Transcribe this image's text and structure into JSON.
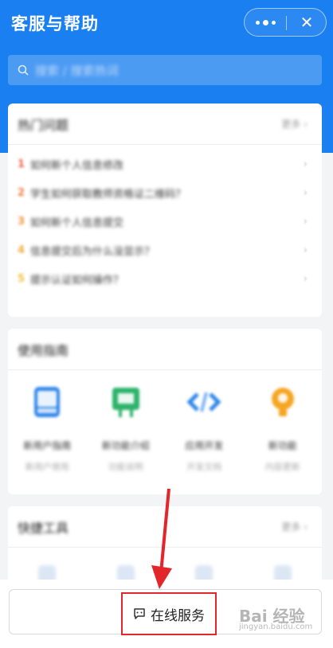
{
  "header": {
    "title": "客服与帮助",
    "more_icon": "more-dots-icon",
    "close_icon": "close-icon",
    "close_glyph": "✕"
  },
  "search": {
    "placeholder": "搜索 / 搜索热词",
    "icon": "search-icon"
  },
  "hot_questions": {
    "title": "热门问题",
    "more": "更多 ›",
    "items": [
      {
        "num": "1",
        "text": "如何新个人信息修改",
        "color": "#f05a3a"
      },
      {
        "num": "2",
        "text": "学生如何获取教师资格证二维码？",
        "color": "#f07a3a"
      },
      {
        "num": "3",
        "text": "如何新个人信息提交",
        "color": "#f0963a"
      },
      {
        "num": "4",
        "text": "信息提交后为什么没显示？",
        "color": "#f0ae3a"
      },
      {
        "num": "5",
        "text": "提示认证如何操作？",
        "color": "#f0c23a"
      }
    ],
    "arrow": "›"
  },
  "guides": {
    "title": "使用指南",
    "items": [
      {
        "label": "新用户指南",
        "sub": "新用户使用",
        "icon": "tablet-icon",
        "color": "#2f86e8"
      },
      {
        "label": "新功能介绍",
        "sub": "功能说明",
        "icon": "presentation-icon",
        "color": "#2db36b"
      },
      {
        "label": "应用开发",
        "sub": "开发文档",
        "icon": "code-icon",
        "color": "#2f86e8"
      },
      {
        "label": "新功能",
        "sub": "内容更新",
        "icon": "lightbulb-icon",
        "color": "#f5a623"
      }
    ]
  },
  "tools": {
    "title": "快捷工具",
    "more": "更多 ›"
  },
  "service": {
    "label": "在线服务",
    "icon": "chat-icon",
    "highlight_color": "#e3262a"
  },
  "watermark": {
    "main": "Bai 经验",
    "sub": "jingyan.baidu.com"
  }
}
